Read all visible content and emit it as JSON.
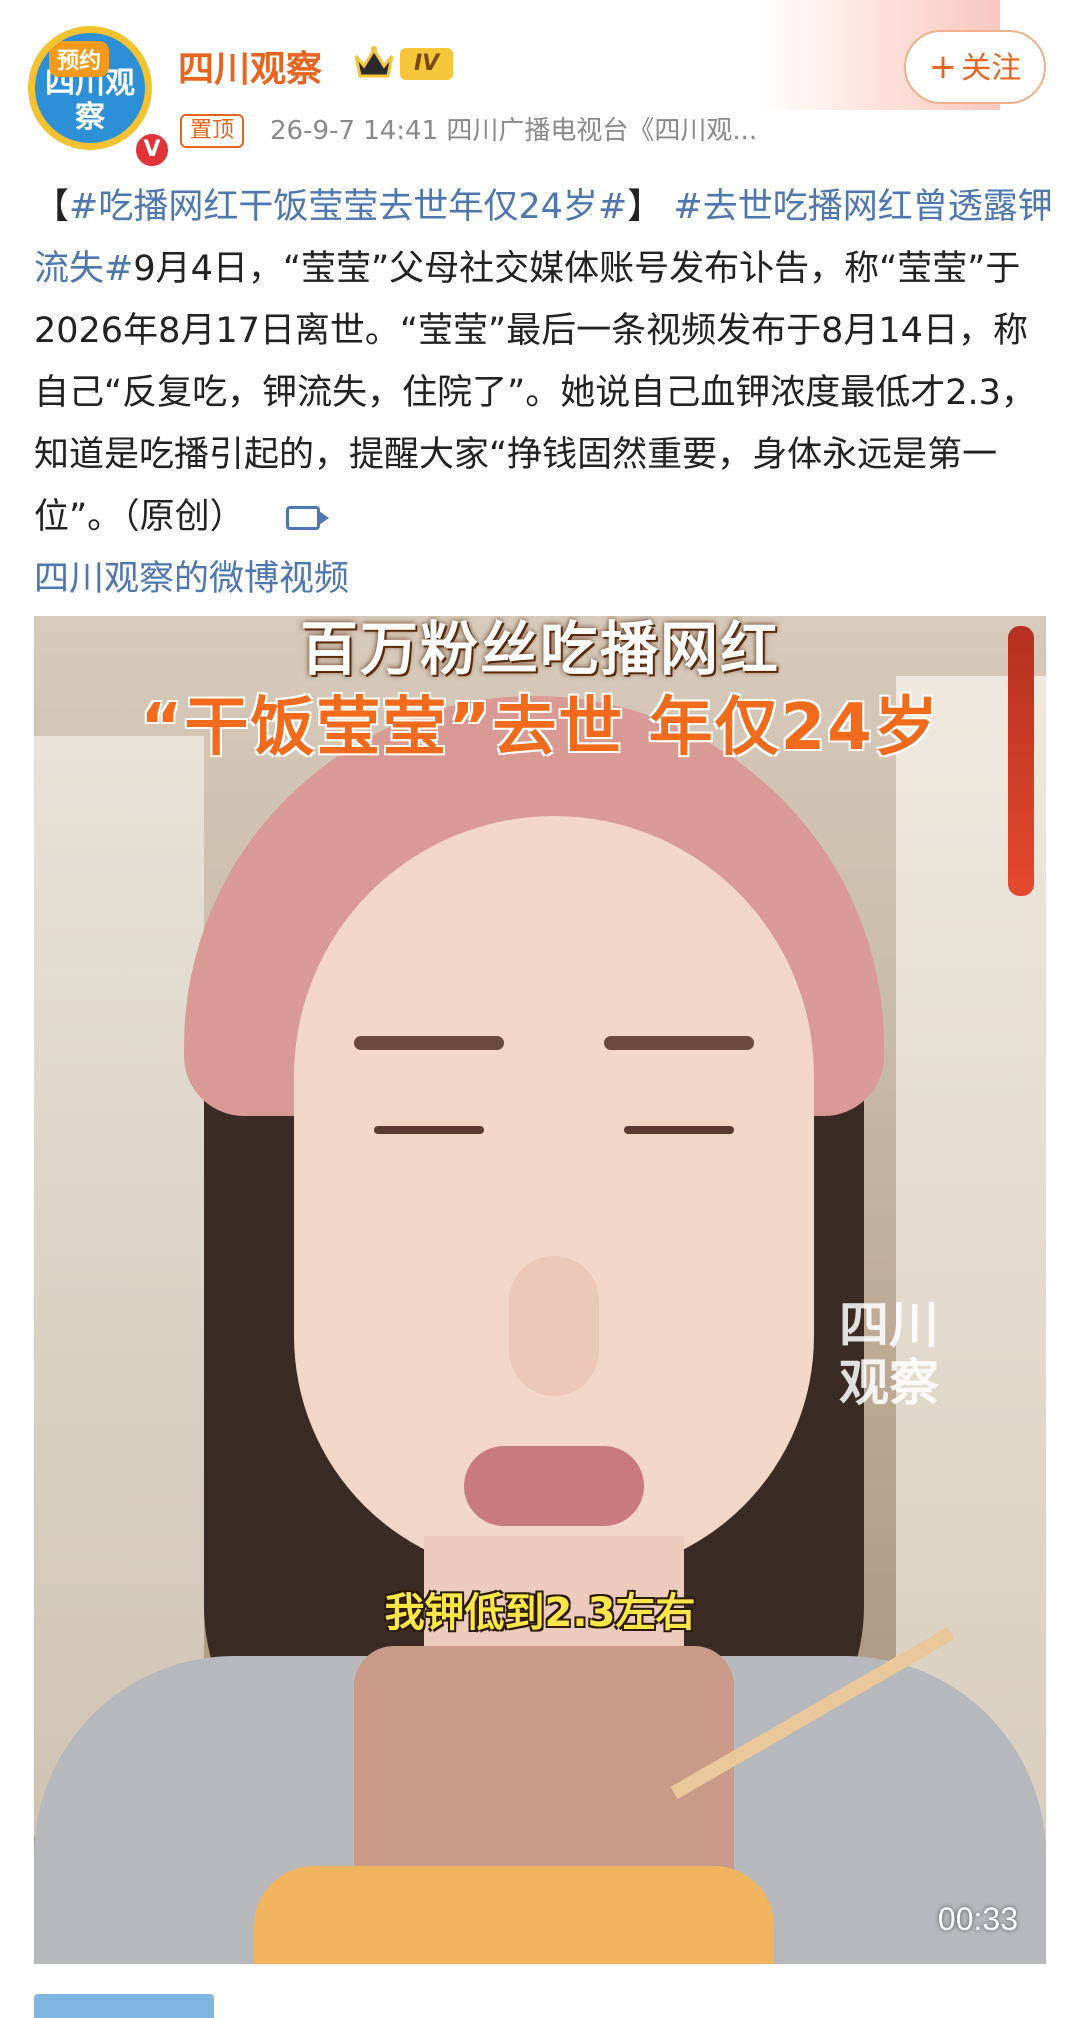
{
  "header": {
    "avatar": {
      "tag": "预约",
      "text": "四川观察"
    },
    "account_name": "四川观察",
    "level": "IV",
    "pinned_label": "置顶",
    "meta": "26-9-7 14:41  四川广播电视台《四川观...",
    "follow_label": "关注",
    "follow_symbol": "+"
  },
  "post": {
    "bracket_open": "【",
    "hashtag1": "#吃播网红干饭莹莹去世年仅24岁#",
    "bracket_close": "】",
    "hashtag2": "#去世吃播网红曾透露钾流失#",
    "body": "9月4日，“莹莹”父母社交媒体账号发布讣告，称“莹莹”于2026年8月17日离世。“莹莹”最后一条视频发布于8月14日，称自己“反复吃，钾流失，住院了”。她说自己血钾浓度最低才2.3，知道是吃播引起的，提醒大家“挣钱固然重要，身体永远是第一位”。（原创）",
    "video_link": "四川观察的微博视频"
  },
  "video": {
    "title_line1": "百万粉丝吃播网红",
    "title_line2": "“干饭莹莹”去世 年仅24岁",
    "watermark": "四川观察",
    "subtitle": "我钾低到2.3左右",
    "duration": "00:33"
  },
  "colors": {
    "brand_orange": "#e8641f",
    "link_blue": "#4e77b0",
    "subtitle_yellow": "#ffe74a"
  }
}
